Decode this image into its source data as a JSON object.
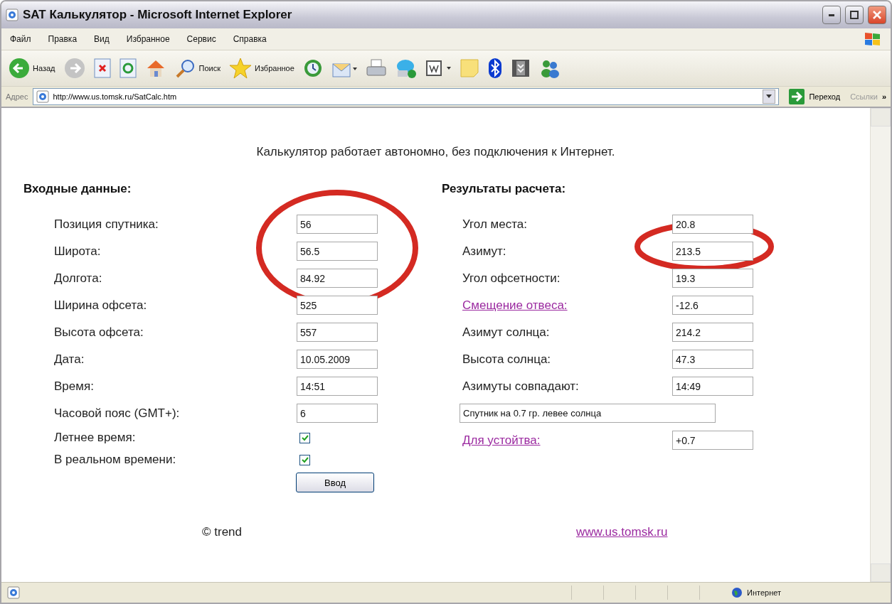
{
  "window": {
    "title": "SAT Калькулятор - Microsoft Internet Explorer"
  },
  "menu": [
    "Файл",
    "Правка",
    "Вид",
    "Избранное",
    "Сервис",
    "Справка"
  ],
  "toolbar": [
    {
      "kind": "back",
      "label": "Назад"
    },
    {
      "kind": "forward"
    },
    {
      "kind": "stop"
    },
    {
      "kind": "refresh"
    },
    {
      "kind": "home"
    },
    {
      "kind": "search",
      "label": "Поиск"
    },
    {
      "kind": "favorites",
      "label": "Избранное"
    },
    {
      "kind": "history"
    },
    {
      "kind": "mail"
    },
    {
      "kind": "print"
    },
    {
      "kind": "phone"
    },
    {
      "kind": "word"
    },
    {
      "kind": "note"
    },
    {
      "kind": "bluetooth"
    },
    {
      "kind": "archive"
    },
    {
      "kind": "messenger"
    }
  ],
  "address": {
    "label": "Адрес",
    "url": "http://www.us.tomsk.ru/SatCalc.htm",
    "go": "Переход",
    "links": "Ссылки",
    "more": "»"
  },
  "page": {
    "notice": "Калькулятор работает автономно, без подключения к Интернет.",
    "inputs": {
      "heading": "Входные данные:",
      "fields": [
        {
          "kind": "text",
          "label": "Позиция спутника:",
          "value": "56"
        },
        {
          "kind": "text",
          "label": "Широта:",
          "value": "56.5"
        },
        {
          "kind": "text",
          "label": "Долгота:",
          "value": "84.92"
        },
        {
          "kind": "text",
          "label": "Ширина офсета:",
          "value": "525"
        },
        {
          "kind": "text",
          "label": "Высота офсета:",
          "value": "557"
        },
        {
          "kind": "text",
          "label": "Дата:",
          "value": "10.05.2009"
        },
        {
          "kind": "text",
          "label": "Время:",
          "value": "14:51"
        },
        {
          "kind": "text",
          "label": "Часовой пояс (GMT+):",
          "value": "6"
        },
        {
          "kind": "checkbox",
          "label": "Летнее время:",
          "checked": true
        },
        {
          "kind": "checkbox",
          "label": "В реальном времени:",
          "checked": true
        }
      ],
      "submit": "Ввод"
    },
    "results": {
      "heading": "Результаты расчета:",
      "fields": [
        {
          "kind": "text",
          "label": "Угол места:",
          "value": "20.8"
        },
        {
          "kind": "text",
          "label": "Азимут:",
          "value": "213.5"
        },
        {
          "kind": "text",
          "label": "Угол офсетности:",
          "value": "19.3"
        },
        {
          "kind": "link",
          "label": "Смещение отвеса:",
          "value": "-12.6"
        },
        {
          "kind": "text",
          "label": "Азимут солнца:",
          "value": "214.2"
        },
        {
          "kind": "text",
          "label": "Высота солнца:",
          "value": "47.3"
        },
        {
          "kind": "text",
          "label": "Азимуты совпадают:",
          "value": "14:49"
        },
        {
          "kind": "message",
          "value": "Спутник на 0.7 гр. левее солнца"
        },
        {
          "kind": "link",
          "label": "Для устойтва:",
          "value": "+0.7"
        }
      ]
    },
    "copyright": "© trend",
    "site_link": "www.us.tomsk.ru"
  },
  "status_bar": {
    "zone": "Интернет"
  }
}
